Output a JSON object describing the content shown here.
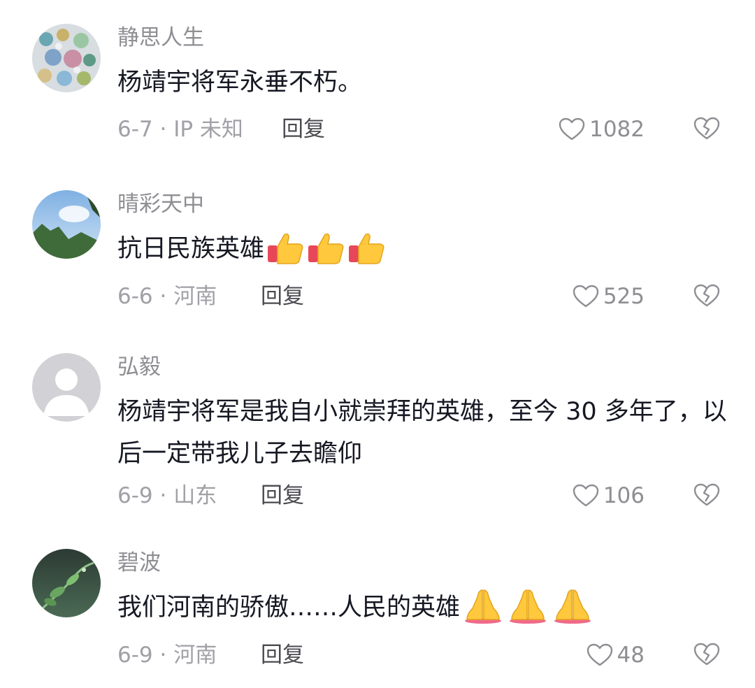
{
  "comments": [
    {
      "username": "静思人生",
      "text": "杨靖宇将军永垂不朽。",
      "date_location": "6-7 · IP 未知",
      "reply_label": "回复",
      "likes": "1082"
    },
    {
      "username": "晴彩天中",
      "text": "抗日民族英雄",
      "emojis": "thumbs-up ×3",
      "date_location": "6-6 · 河南",
      "reply_label": "回复",
      "likes": "525"
    },
    {
      "username": "弘毅",
      "text": "杨靖宇将军是我自小就崇拜的英雄，至今 30 多年了，以后一定带我儿子去瞻仰",
      "date_location": "6-9 · 山东",
      "reply_label": "回复",
      "likes": "106"
    },
    {
      "username": "碧波",
      "text": "我们河南的骄傲……人民的英雄",
      "emojis": "folded-hands ×3",
      "date_location": "6-9 · 河南",
      "reply_label": "回复",
      "likes": "48"
    }
  ],
  "colors": {
    "username": "#8e8e93",
    "text": "#161823",
    "meta": "#a0a0a6",
    "reply": "#4a4a50",
    "background": "#ffffff"
  },
  "icons": {
    "like": "heart-outline-icon",
    "dislike": "broken-heart-icon"
  }
}
